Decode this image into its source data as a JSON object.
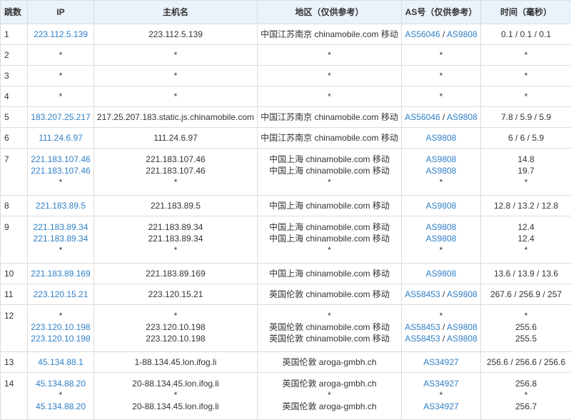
{
  "headers": {
    "hop": "跳数",
    "ip": "IP",
    "host": "主机名",
    "region": "地区（仅供参考）",
    "as": "AS号（仅供参考）",
    "time": "时间（毫秒）"
  },
  "rows": [
    {
      "hop": "1",
      "lines": [
        {
          "ip": "223.112.5.139",
          "host": "223.112.5.139",
          "region": "中国江苏南京 chinamobile.com 移动",
          "as": [
            "AS56046",
            "AS9808"
          ],
          "time": "0.1 / 0.1 / 0.1"
        }
      ]
    },
    {
      "hop": "2",
      "lines": [
        {
          "ip": "*",
          "host": "*",
          "region": "*",
          "as": [
            "*"
          ],
          "time": "*"
        }
      ]
    },
    {
      "hop": "3",
      "lines": [
        {
          "ip": "*",
          "host": "*",
          "region": "*",
          "as": [
            "*"
          ],
          "time": "*"
        }
      ]
    },
    {
      "hop": "4",
      "lines": [
        {
          "ip": "*",
          "host": "*",
          "region": "*",
          "as": [
            "*"
          ],
          "time": "*"
        }
      ]
    },
    {
      "hop": "5",
      "lines": [
        {
          "ip": "183.207.25.217",
          "host": "217.25.207.183.static.js.chinamobile.com",
          "region": "中国江苏南京 chinamobile.com 移动",
          "as": [
            "AS56046",
            "AS9808"
          ],
          "time": "7.8 / 5.9 / 5.9"
        }
      ]
    },
    {
      "hop": "6",
      "lines": [
        {
          "ip": "111.24.6.97",
          "host": "111.24.6.97",
          "region": "中国江苏南京 chinamobile.com 移动",
          "as": [
            "AS9808"
          ],
          "time": "6 / 6 / 5.9"
        }
      ]
    },
    {
      "hop": "7",
      "lines": [
        {
          "ip": "221.183.107.46",
          "host": "221.183.107.46",
          "region": "中国上海 chinamobile.com 移动",
          "as": [
            "AS9808"
          ],
          "time": "14.8"
        },
        {
          "ip": "221.183.107.46",
          "host": "221.183.107.46",
          "region": "中国上海 chinamobile.com 移动",
          "as": [
            "AS9808"
          ],
          "time": "19.7"
        },
        {
          "ip": "*",
          "host": "*",
          "region": "*",
          "as": [
            "*"
          ],
          "time": "*"
        }
      ]
    },
    {
      "hop": "8",
      "lines": [
        {
          "ip": "221.183.89.5",
          "host": "221.183.89.5",
          "region": "中国上海 chinamobile.com 移动",
          "as": [
            "AS9808"
          ],
          "time": "12.8 / 13.2 / 12.8"
        }
      ]
    },
    {
      "hop": "9",
      "lines": [
        {
          "ip": "221.183.89.34",
          "host": "221.183.89.34",
          "region": "中国上海 chinamobile.com 移动",
          "as": [
            "AS9808"
          ],
          "time": "12.4"
        },
        {
          "ip": "221.183.89.34",
          "host": "221.183.89.34",
          "region": "中国上海 chinamobile.com 移动",
          "as": [
            "AS9808"
          ],
          "time": "12.4"
        },
        {
          "ip": "*",
          "host": "*",
          "region": "*",
          "as": [
            "*"
          ],
          "time": "*"
        }
      ]
    },
    {
      "hop": "10",
      "lines": [
        {
          "ip": "221.183.89.169",
          "host": "221.183.89.169",
          "region": "中国上海 chinamobile.com 移动",
          "as": [
            "AS9808"
          ],
          "time": "13.6 / 13.9 / 13.6"
        }
      ]
    },
    {
      "hop": "11",
      "lines": [
        {
          "ip": "223.120.15.21",
          "host": "223.120.15.21",
          "region": "英国伦敦 chinamobile.com 移动",
          "as": [
            "AS58453",
            "AS9808"
          ],
          "time": "267.6 / 256.9 / 257"
        }
      ]
    },
    {
      "hop": "12",
      "lines": [
        {
          "ip": "*",
          "host": "*",
          "region": "*",
          "as": [
            "*"
          ],
          "time": "*"
        },
        {
          "ip": "223.120.10.198",
          "host": "223.120.10.198",
          "region": "英国伦敦 chinamobile.com 移动",
          "as": [
            "AS58453",
            "AS9808"
          ],
          "time": "255.6"
        },
        {
          "ip": "223.120.10.198",
          "host": "223.120.10.198",
          "region": "英国伦敦 chinamobile.com 移动",
          "as": [
            "AS58453",
            "AS9808"
          ],
          "time": "255.5"
        }
      ]
    },
    {
      "hop": "13",
      "lines": [
        {
          "ip": "45.134.88.1",
          "host": "1-88.134.45.lon.ifog.li",
          "region": "英国伦敦 aroga-gmbh.ch",
          "as": [
            "AS34927"
          ],
          "time": "256.6 / 256.6 / 256.6"
        }
      ]
    },
    {
      "hop": "14",
      "lines": [
        {
          "ip": "45.134.88.20",
          "host": "20-88.134.45.lon.ifog.li",
          "region": "英国伦敦 aroga-gmbh.ch",
          "as": [
            "AS34927"
          ],
          "time": "256.8"
        },
        {
          "ip": "*",
          "host": "*",
          "region": "*",
          "as": [
            "*"
          ],
          "time": "*"
        },
        {
          "ip": "45.134.88.20",
          "host": "20-88.134.45.lon.ifog.li",
          "region": "英国伦敦 aroga-gmbh.ch",
          "as": [
            "AS34927"
          ],
          "time": "256.7"
        }
      ]
    }
  ],
  "colors": {
    "link": "#2f7fc6",
    "header_bg": "#eaf3fb",
    "border": "#dcdcdc",
    "text": "#333333"
  }
}
